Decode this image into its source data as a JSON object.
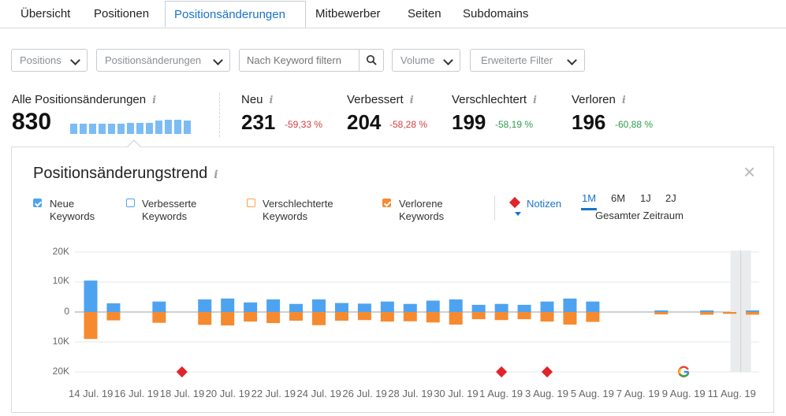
{
  "tabs": [
    "Übersicht",
    "Positionen",
    "Positionsänderungen",
    "Mitbewerber",
    "Seiten",
    "Subdomains"
  ],
  "active_tab": "Positionsänderungen",
  "filters": {
    "positions": "Positions",
    "changes": "Positionsänderungen",
    "keyword_placeholder": "Nach Keyword filtern",
    "volume": "Volume",
    "advanced": "Erweiterte Filter"
  },
  "info_glyph": "i",
  "stats": {
    "all": {
      "label": "Alle Positionsänderungen",
      "value": "830",
      "sparkline": [
        0.55,
        0.55,
        0.55,
        0.55,
        0.55,
        0.55,
        0.6,
        0.6,
        0.6,
        0.7,
        0.75,
        0.75,
        0.7
      ]
    },
    "new": {
      "label": "Neu",
      "value": "231",
      "change": "-59,33 %"
    },
    "improved": {
      "label": "Verbessert",
      "value": "204",
      "change": "-58,28 %"
    },
    "declined": {
      "label": "Verschlechtert",
      "value": "199",
      "change": "-58,19 %"
    },
    "lost": {
      "label": "Verloren",
      "value": "196",
      "change": "-60,88 %"
    }
  },
  "trend": {
    "title": "Positionsänderungstrend",
    "close": "×",
    "legend": [
      {
        "line1": "Neue",
        "line2": "Keywords",
        "checked": true,
        "color": "#4ea3f0"
      },
      {
        "line1": "Verbesserte",
        "line2": "Keywords",
        "checked": false,
        "color": "#4ea3f0"
      },
      {
        "line1": "Verschlechterte",
        "line2": "Keywords",
        "checked": false,
        "color": "#f7a24e"
      },
      {
        "line1": "Verlorene",
        "line2": "Keywords",
        "checked": true,
        "color": "#f68a2f"
      }
    ],
    "notes": "Notizen",
    "periods": [
      "1M",
      "6M",
      "1J",
      "2J"
    ],
    "active_period": "1M",
    "all_time": "Gesamter Zeitraum"
  },
  "chart_data": {
    "type": "bar",
    "yticks": [
      "20K",
      "10K",
      "0",
      "10K",
      "20K"
    ],
    "ylim": [
      -20000,
      20000
    ],
    "xticks": [
      "14 Jul. 19",
      "16 Jul. 19",
      "18 Jul. 19",
      "20 Jul. 19",
      "22 Jul. 19",
      "24 Jul. 19",
      "26 Jul. 19",
      "28 Jul. 19",
      "30 Jul. 19",
      "1 Aug. 19",
      "3 Aug. 19",
      "5 Aug. 19",
      "7 Aug. 19",
      "9 Aug. 19",
      "11 Aug. 19"
    ],
    "series": [
      {
        "name": "Neue Keywords",
        "color": "#4ea3f0",
        "values": [
          10500,
          2900,
          0,
          3500,
          0,
          4200,
          4500,
          3200,
          4200,
          2700,
          4200,
          3000,
          2800,
          3500,
          2700,
          3800,
          4200,
          2400,
          2700,
          2400,
          3500,
          4500,
          3500,
          0,
          0,
          200,
          0,
          400,
          0,
          400,
          0,
          0
        ]
      },
      {
        "name": "Verlorene Keywords",
        "color": "#f68a2f",
        "values": [
          -9000,
          -2800,
          0,
          -3600,
          0,
          -4300,
          -4500,
          -3200,
          -3700,
          -2900,
          -4400,
          -2900,
          -2700,
          -3200,
          -3100,
          -3500,
          -4200,
          -2400,
          -2700,
          -2400,
          -3200,
          -4200,
          -3300,
          0,
          0,
          -800,
          0,
          -900,
          -600,
          -900,
          0,
          -400
        ]
      }
    ],
    "note_days": [
      4,
      18,
      20
    ],
    "event_day": 26
  }
}
